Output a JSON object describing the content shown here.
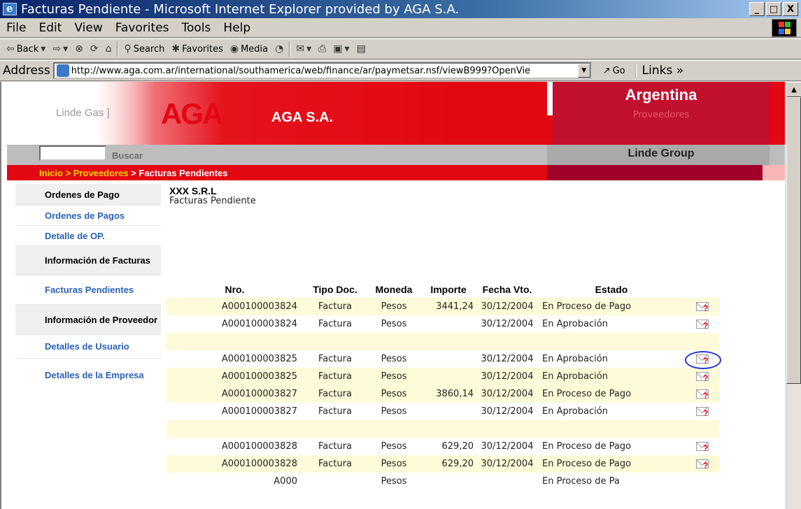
{
  "window": {
    "title": "Facturas Pendiente - Microsoft Internet Explorer provided by AGA S.A.",
    "buttons": [
      "_",
      "□",
      "X"
    ]
  },
  "menu": [
    "File",
    "Edit",
    "View",
    "Favorites",
    "Tools",
    "Help"
  ],
  "toolbar": {
    "back": "Back",
    "search": "Search",
    "favorites": "Favorites",
    "media": "Media"
  },
  "address": {
    "label": "Address",
    "url": "http://www.aga.com.ar/international/southamerica/web/finance/ar/paymetsar.nsf/viewB999?OpenVie",
    "go": "Go",
    "links": "Links »"
  },
  "header": {
    "linde": "Linde Gas ]",
    "logo": "AGA",
    "company": "AGA S.A.",
    "country": "Argentina",
    "section": "Proveedores",
    "group": "Linde Group",
    "search_button": "Buscar"
  },
  "breadcrumb": {
    "inicio": "Inicio",
    "sep1": " > ",
    "proveedores": "Proveedores",
    "sep2": " > ",
    "current": "Facturas Pendientes"
  },
  "sidebar": {
    "items": [
      {
        "label": "Ordenes de Pago",
        "type": "head"
      },
      {
        "label": "Ordenes de Pagos",
        "type": "link"
      },
      {
        "label": "Detalle de OP.",
        "type": "link"
      },
      {
        "label": "Información de Facturas",
        "type": "head"
      },
      {
        "label": "Facturas Pendientes",
        "type": "link"
      },
      {
        "label": "Información de Proveedor",
        "type": "head"
      },
      {
        "label": "Detalles de Usuario",
        "type": "link"
      },
      {
        "label": "Detalles de la Empresa",
        "type": "link"
      }
    ]
  },
  "content": {
    "company": "XXX S.R.L",
    "subtitle": "Facturas Pendiente"
  },
  "table": {
    "headers": [
      "Nro.",
      "Tipo Doc.",
      "Moneda",
      "Importe",
      "Fecha Vto.",
      "Estado"
    ],
    "rows": [
      {
        "nro": "A000100003824",
        "tipo": "Factura",
        "moneda": "Pesos",
        "importe": "3441,24",
        "fecha": "30/12/2004",
        "estado": "En Proceso de Pago",
        "icon": true,
        "bg": "y"
      },
      {
        "nro": "A000100003824",
        "tipo": "Factura",
        "moneda": "Pesos",
        "importe": "",
        "fecha": "30/12/2004",
        "estado": "En Aprobación",
        "icon": true,
        "bg": "w"
      },
      {
        "nro": "",
        "tipo": "",
        "moneda": "",
        "importe": "",
        "fecha": "",
        "estado": "",
        "icon": false,
        "bg": "y"
      },
      {
        "nro": "A000100003825",
        "tipo": "Factura",
        "moneda": "Pesos",
        "importe": "",
        "fecha": "30/12/2004",
        "estado": "En Aprobación",
        "icon": true,
        "bg": "w",
        "circled": true
      },
      {
        "nro": "A000100003825",
        "tipo": "Factura",
        "moneda": "Pesos",
        "importe": "",
        "fecha": "30/12/2004",
        "estado": "En Aprobación",
        "icon": true,
        "bg": "y"
      },
      {
        "nro": "A000100003827",
        "tipo": "Factura",
        "moneda": "Pesos",
        "importe": "3860,14",
        "fecha": "30/12/2004",
        "estado": "En Proceso de Pago",
        "icon": true,
        "bg": "y"
      },
      {
        "nro": "A000100003827",
        "tipo": "Factura",
        "moneda": "Pesos",
        "importe": "",
        "fecha": "30/12/2004",
        "estado": "En Aprobación",
        "icon": true,
        "bg": "w"
      },
      {
        "nro": "",
        "tipo": "",
        "moneda": "",
        "importe": "",
        "fecha": "",
        "estado": "",
        "icon": false,
        "bg": "y"
      },
      {
        "nro": "A000100003828",
        "tipo": "Factura",
        "moneda": "Pesos",
        "importe": "629,20",
        "fecha": "30/12/2004",
        "estado": "En Proceso de Pago",
        "icon": true,
        "bg": "w"
      },
      {
        "nro": "A000100003828",
        "tipo": "Factura",
        "moneda": "Pesos",
        "importe": "629,20",
        "fecha": "30/12/2004",
        "estado": "En Proceso de Pago",
        "icon": true,
        "bg": "y"
      },
      {
        "nro": "A000",
        "tipo": "",
        "moneda": "Pesos",
        "importe": "",
        "fecha": "",
        "estado": "En Proceso de Pa",
        "icon": false,
        "bg": "w"
      }
    ]
  },
  "colors": {
    "brand_red": "#e30613",
    "dark_red": "#c2102f",
    "link_blue": "#2b62b8",
    "breadcrumb_link": "#ffd200",
    "row_yellow": "#fffbd9"
  }
}
